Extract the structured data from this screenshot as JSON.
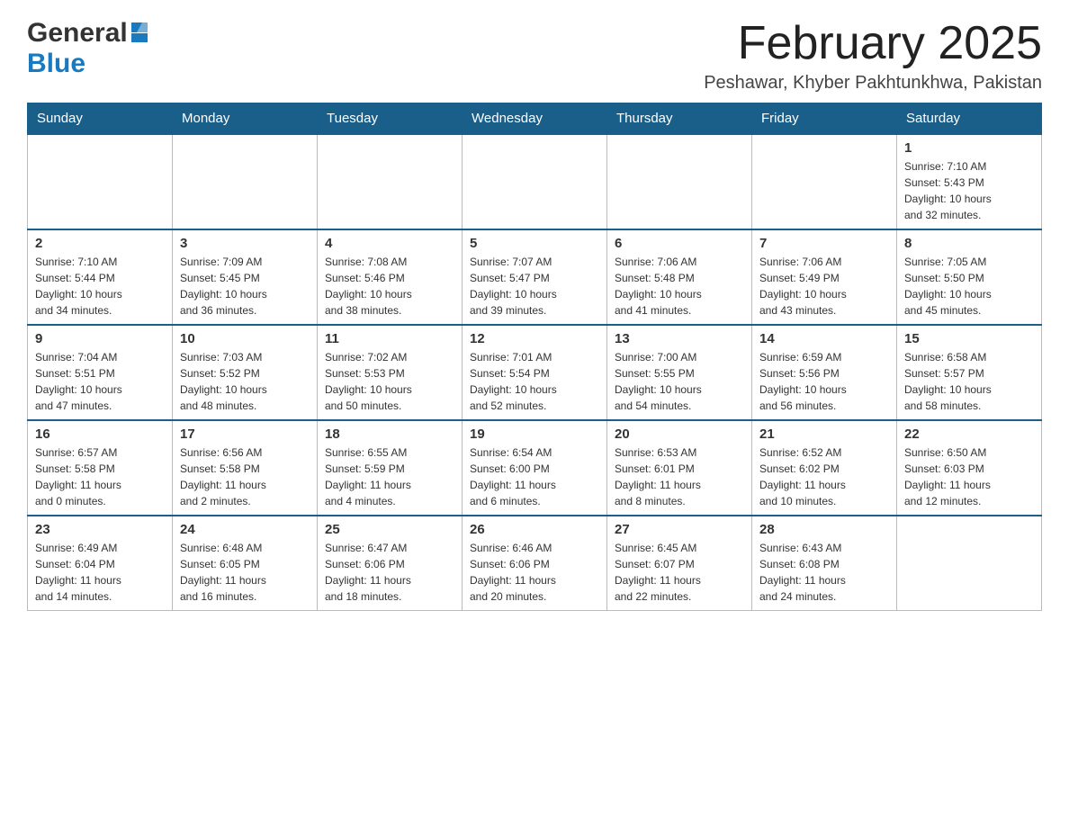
{
  "header": {
    "logo_general": "General",
    "logo_blue": "Blue",
    "month_title": "February 2025",
    "location": "Peshawar, Khyber Pakhtunkhwa, Pakistan"
  },
  "weekdays": [
    "Sunday",
    "Monday",
    "Tuesday",
    "Wednesday",
    "Thursday",
    "Friday",
    "Saturday"
  ],
  "weeks": [
    [
      {
        "day": "",
        "info": ""
      },
      {
        "day": "",
        "info": ""
      },
      {
        "day": "",
        "info": ""
      },
      {
        "day": "",
        "info": ""
      },
      {
        "day": "",
        "info": ""
      },
      {
        "day": "",
        "info": ""
      },
      {
        "day": "1",
        "info": "Sunrise: 7:10 AM\nSunset: 5:43 PM\nDaylight: 10 hours\nand 32 minutes."
      }
    ],
    [
      {
        "day": "2",
        "info": "Sunrise: 7:10 AM\nSunset: 5:44 PM\nDaylight: 10 hours\nand 34 minutes."
      },
      {
        "day": "3",
        "info": "Sunrise: 7:09 AM\nSunset: 5:45 PM\nDaylight: 10 hours\nand 36 minutes."
      },
      {
        "day": "4",
        "info": "Sunrise: 7:08 AM\nSunset: 5:46 PM\nDaylight: 10 hours\nand 38 minutes."
      },
      {
        "day": "5",
        "info": "Sunrise: 7:07 AM\nSunset: 5:47 PM\nDaylight: 10 hours\nand 39 minutes."
      },
      {
        "day": "6",
        "info": "Sunrise: 7:06 AM\nSunset: 5:48 PM\nDaylight: 10 hours\nand 41 minutes."
      },
      {
        "day": "7",
        "info": "Sunrise: 7:06 AM\nSunset: 5:49 PM\nDaylight: 10 hours\nand 43 minutes."
      },
      {
        "day": "8",
        "info": "Sunrise: 7:05 AM\nSunset: 5:50 PM\nDaylight: 10 hours\nand 45 minutes."
      }
    ],
    [
      {
        "day": "9",
        "info": "Sunrise: 7:04 AM\nSunset: 5:51 PM\nDaylight: 10 hours\nand 47 minutes."
      },
      {
        "day": "10",
        "info": "Sunrise: 7:03 AM\nSunset: 5:52 PM\nDaylight: 10 hours\nand 48 minutes."
      },
      {
        "day": "11",
        "info": "Sunrise: 7:02 AM\nSunset: 5:53 PM\nDaylight: 10 hours\nand 50 minutes."
      },
      {
        "day": "12",
        "info": "Sunrise: 7:01 AM\nSunset: 5:54 PM\nDaylight: 10 hours\nand 52 minutes."
      },
      {
        "day": "13",
        "info": "Sunrise: 7:00 AM\nSunset: 5:55 PM\nDaylight: 10 hours\nand 54 minutes."
      },
      {
        "day": "14",
        "info": "Sunrise: 6:59 AM\nSunset: 5:56 PM\nDaylight: 10 hours\nand 56 minutes."
      },
      {
        "day": "15",
        "info": "Sunrise: 6:58 AM\nSunset: 5:57 PM\nDaylight: 10 hours\nand 58 minutes."
      }
    ],
    [
      {
        "day": "16",
        "info": "Sunrise: 6:57 AM\nSunset: 5:58 PM\nDaylight: 11 hours\nand 0 minutes."
      },
      {
        "day": "17",
        "info": "Sunrise: 6:56 AM\nSunset: 5:58 PM\nDaylight: 11 hours\nand 2 minutes."
      },
      {
        "day": "18",
        "info": "Sunrise: 6:55 AM\nSunset: 5:59 PM\nDaylight: 11 hours\nand 4 minutes."
      },
      {
        "day": "19",
        "info": "Sunrise: 6:54 AM\nSunset: 6:00 PM\nDaylight: 11 hours\nand 6 minutes."
      },
      {
        "day": "20",
        "info": "Sunrise: 6:53 AM\nSunset: 6:01 PM\nDaylight: 11 hours\nand 8 minutes."
      },
      {
        "day": "21",
        "info": "Sunrise: 6:52 AM\nSunset: 6:02 PM\nDaylight: 11 hours\nand 10 minutes."
      },
      {
        "day": "22",
        "info": "Sunrise: 6:50 AM\nSunset: 6:03 PM\nDaylight: 11 hours\nand 12 minutes."
      }
    ],
    [
      {
        "day": "23",
        "info": "Sunrise: 6:49 AM\nSunset: 6:04 PM\nDaylight: 11 hours\nand 14 minutes."
      },
      {
        "day": "24",
        "info": "Sunrise: 6:48 AM\nSunset: 6:05 PM\nDaylight: 11 hours\nand 16 minutes."
      },
      {
        "day": "25",
        "info": "Sunrise: 6:47 AM\nSunset: 6:06 PM\nDaylight: 11 hours\nand 18 minutes."
      },
      {
        "day": "26",
        "info": "Sunrise: 6:46 AM\nSunset: 6:06 PM\nDaylight: 11 hours\nand 20 minutes."
      },
      {
        "day": "27",
        "info": "Sunrise: 6:45 AM\nSunset: 6:07 PM\nDaylight: 11 hours\nand 22 minutes."
      },
      {
        "day": "28",
        "info": "Sunrise: 6:43 AM\nSunset: 6:08 PM\nDaylight: 11 hours\nand 24 minutes."
      },
      {
        "day": "",
        "info": ""
      }
    ]
  ]
}
